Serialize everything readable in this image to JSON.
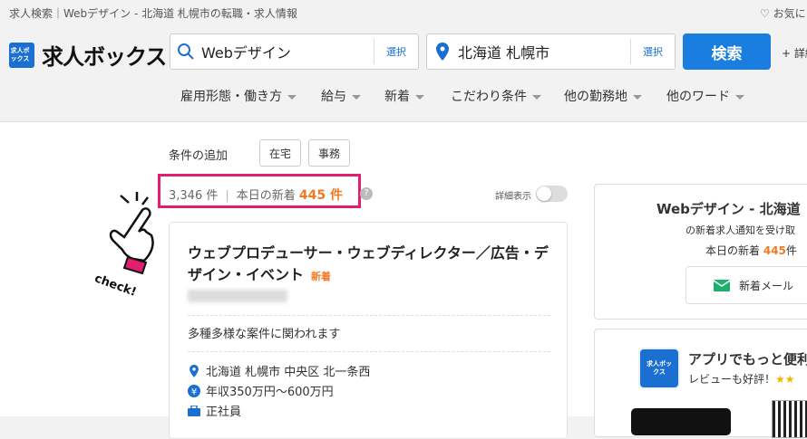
{
  "header": {
    "breadcrumb": "求人検索｜Webデザイン - 北海道 札幌市の転職・求人情報",
    "favorites": "お気に",
    "logo_text": "求人ボックス",
    "logo_box": "求人ボックス",
    "keyword": {
      "value": "Webデザイン",
      "select": "選択"
    },
    "location": {
      "value": "北海道 札幌市",
      "select": "選択"
    },
    "search_button": "検索",
    "plus": "+ 詳細"
  },
  "menu": [
    "雇用形態・働き方",
    "給与",
    "新着",
    "こだわり条件",
    "他の勤務地",
    "他のワード"
  ],
  "conditions": {
    "label": "条件の追加",
    "chips": [
      "在宅",
      "事務"
    ]
  },
  "results": {
    "total": "3,346 件",
    "today_label": "本日の新着",
    "today_count": "445 件",
    "help": "?",
    "detail_toggle": "詳細表示",
    "check_label": "check!"
  },
  "job": {
    "title": "ウェブプロデューサー・ウェブディレクター／広告・デザイン・イベント",
    "badge": "新着",
    "description": "多種多様な案件に関われます",
    "location": "北海道 札幌市 中央区 北一条西",
    "salary": "年収350万円〜600万円",
    "employment": "正社員"
  },
  "side_panel": {
    "title": "Webデザイン - 北海道",
    "subtitle": "の新着求人通知を受け取",
    "today_label": "本日の新着",
    "today_count": "445",
    "today_unit": "件",
    "mail_button": "新着メール"
  },
  "app_panel": {
    "title": "アプリでもっと便利",
    "subtitle": "レビューも好評！",
    "stars": "★★",
    "icon_text": "求人ボックス"
  },
  "colors": {
    "accent": "#1a7de0",
    "orange": "#f07a24",
    "highlight": "#e21f6f"
  }
}
